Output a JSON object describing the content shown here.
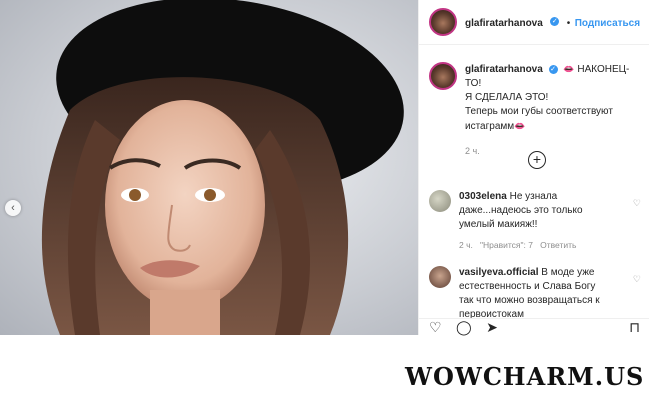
{
  "post": {
    "username": "glafiratarhanova",
    "verified_mark": "✓",
    "follow_label": "Подписаться",
    "caption_line1": "НАКОНЕЦ-ТО!",
    "caption_line2": "Я СДЕЛАЛА ЭТО!",
    "caption_line3": "Теперь мои губы соответствуют",
    "caption_line4": "истаграмм",
    "caption_time": "2 ч.",
    "emoji_icon": "lips-icon"
  },
  "comments": [
    {
      "username": "0303elena",
      "text_line1": "Не узнала",
      "text_line2": "даже...надеюсь это только",
      "text_line3": "умелый макияж!!",
      "time": "2 ч.",
      "likes": "\"Нравится\": 7",
      "reply": "Ответить"
    },
    {
      "username": "vasilyeva.official",
      "text_line1": "В моде уже",
      "text_line2": "естественность и Слава Богу",
      "text_line3": "так что можно возвращаться к",
      "text_line4": "первоистокам"
    }
  ],
  "actions": {
    "like_icon": "heart-icon",
    "comment_icon": "comment-icon",
    "share_icon": "share-icon",
    "save_icon": "bookmark-icon"
  },
  "watermark": "WOWCHARM.US",
  "colors": {
    "link": "#3897f0",
    "text": "#262626",
    "muted": "#8e8e8e",
    "story_ring": "#c13584"
  }
}
